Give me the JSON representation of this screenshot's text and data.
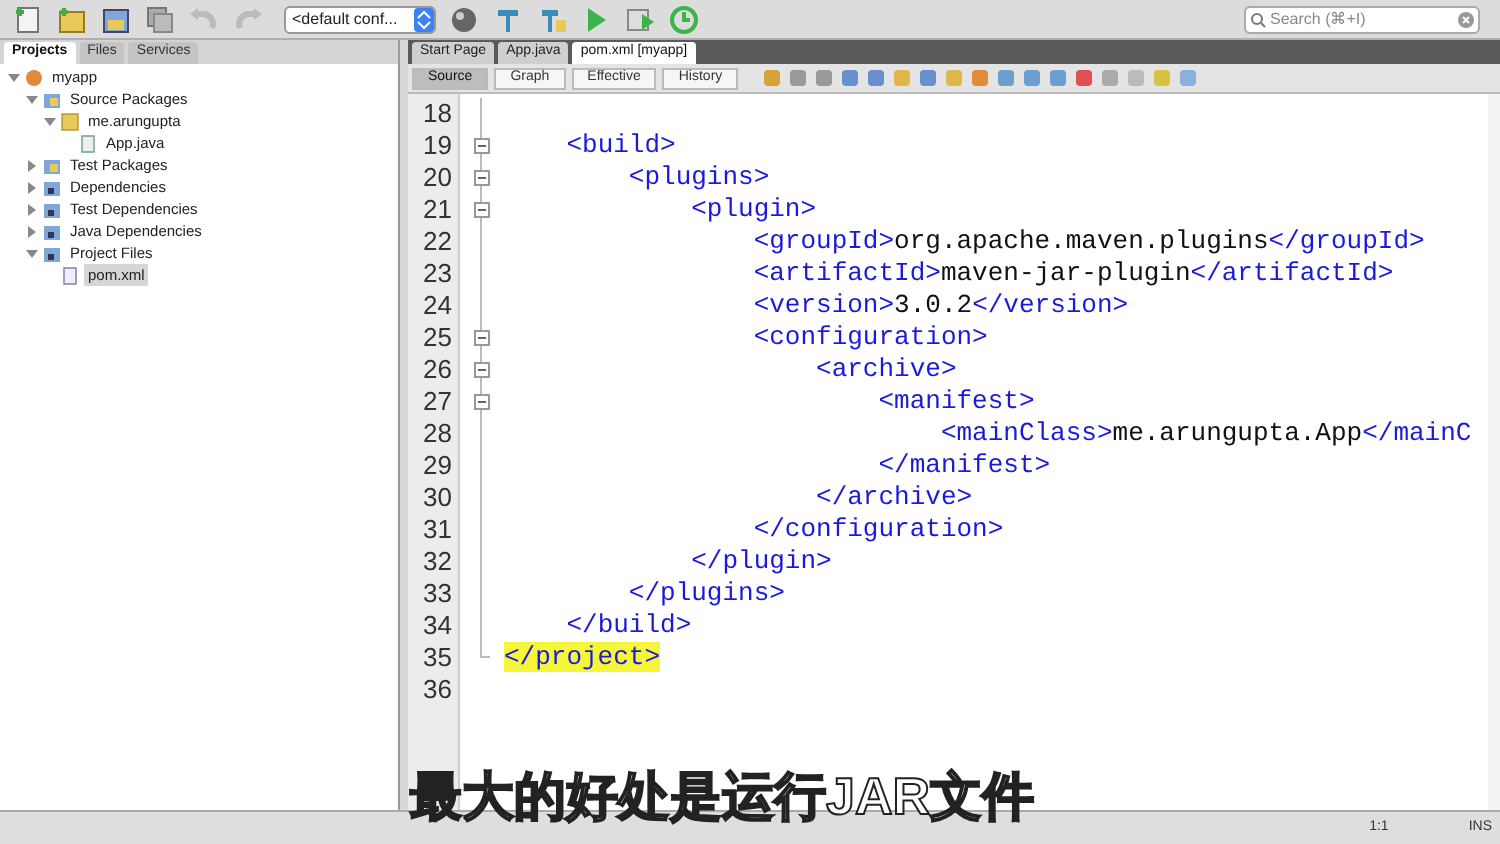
{
  "toolbar": {
    "config": "<default conf...",
    "search": {
      "placeholder": "Search (⌘+I)"
    }
  },
  "left_tabs": [
    {
      "label": "Projects",
      "selected": true
    },
    {
      "label": "Files",
      "selected": false
    },
    {
      "label": "Services",
      "selected": false
    }
  ],
  "tree": [
    {
      "label": "myapp",
      "kind": "project",
      "expanded": true,
      "children": [
        {
          "label": "Source Packages",
          "kind": "package-folder",
          "expanded": true,
          "children": [
            {
              "label": "me.arungupta",
              "kind": "package",
              "expanded": true,
              "children": [
                {
                  "label": "App.java",
                  "kind": "java",
                  "selected": false
                }
              ]
            }
          ]
        },
        {
          "label": "Test Packages",
          "kind": "package-folder",
          "expanded": false
        },
        {
          "label": "Dependencies",
          "kind": "folder",
          "expanded": false
        },
        {
          "label": "Test Dependencies",
          "kind": "folder",
          "expanded": false
        },
        {
          "label": "Java Dependencies",
          "kind": "folder",
          "expanded": false
        },
        {
          "label": "Project Files",
          "kind": "folder",
          "expanded": true,
          "children": [
            {
              "label": "pom.xml",
              "kind": "xml",
              "selected": true
            }
          ]
        }
      ]
    }
  ],
  "editor_tabs": [
    {
      "label": "Start Page",
      "selected": false
    },
    {
      "label": "App.java",
      "selected": false
    },
    {
      "label": "pom.xml [myapp]",
      "selected": true
    }
  ],
  "view_tabs": [
    {
      "label": "Source",
      "selected": true
    },
    {
      "label": "Graph",
      "selected": false
    },
    {
      "label": "Effective",
      "selected": false
    },
    {
      "label": "History",
      "selected": false
    }
  ],
  "code_lines": [
    {
      "number": "18",
      "kind": "body"
    },
    {
      "number": "19",
      "text": "    <build>",
      "kind": "fold-start"
    },
    {
      "number": "20",
      "text": "        <plugins>",
      "kind": "fold-start"
    },
    {
      "number": "21",
      "text": "            <plugin>",
      "kind": "fold-start"
    },
    {
      "number": "22",
      "text": "                <groupId>org.apache.maven.plugins</groupId>",
      "kind": "body"
    },
    {
      "number": "23",
      "text": "                <artifactId>maven-jar-plugin</artifactId>",
      "kind": "body"
    },
    {
      "number": "24",
      "text": "                <version>3.0.2</version>",
      "kind": "body"
    },
    {
      "number": "25",
      "text": "                <configuration>",
      "kind": "fold-start"
    },
    {
      "number": "26",
      "text": "                    <archive>",
      "kind": "fold-start"
    },
    {
      "number": "27",
      "text": "                        <manifest>",
      "kind": "fold-start"
    },
    {
      "number": "28",
      "text": "                            <mainClass>me.arungupta.App</mainC",
      "kind": "body"
    },
    {
      "number": "29",
      "text": "                        </manifest>",
      "kind": "body"
    },
    {
      "number": "30",
      "text": "                    </archive>",
      "kind": "body"
    },
    {
      "number": "31",
      "text": "                </configuration>",
      "kind": "body"
    },
    {
      "number": "32",
      "text": "            </plugin>",
      "kind": "body"
    },
    {
      "number": "33",
      "text": "        </plugins>",
      "kind": "body"
    },
    {
      "number": "34",
      "text": "    </build>",
      "kind": "body"
    },
    {
      "number": "35",
      "text": "</project>",
      "kind": "fold-end",
      "highlighted": true
    },
    {
      "number": "36",
      "kind": "plain"
    }
  ],
  "subtitle": "最大的好处是运行JAR文件",
  "status_bar": {
    "position": "1:1",
    "mode": "INS"
  }
}
